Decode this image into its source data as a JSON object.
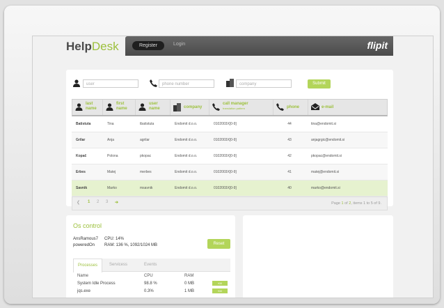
{
  "app": {
    "logo_bold": "Help",
    "logo_light": "Desk",
    "brand": "flipit"
  },
  "nav": {
    "register": "Register",
    "login": "Login"
  },
  "search": {
    "user_placeholder": "user",
    "phone_placeholder": "phone number",
    "company_placeholder": "company",
    "submit": "Submit"
  },
  "table": {
    "headers": [
      {
        "label": "last",
        "sub": "name",
        "icon": "user-icon"
      },
      {
        "label": "first",
        "sub": "name",
        "icon": "user-icon"
      },
      {
        "label": "user",
        "sub": "name",
        "icon": "user-icon"
      },
      {
        "label": "company",
        "sub": "",
        "icon": "building-icon"
      },
      {
        "label": "call manager",
        "sub": "translation pattern",
        "icon": "phone-icon"
      },
      {
        "label": "phone",
        "sub": "",
        "icon": "phone-icon"
      },
      {
        "label": "e-mail",
        "sub": "",
        "icon": "envelope-icon"
      }
    ],
    "rows": [
      [
        "Batistuta",
        "Tina",
        "tbatistuta",
        "Endomit d.o.o.",
        "0102003X[0-9]",
        "44",
        "tina@endomit.si"
      ],
      [
        "Grilar",
        "Anja",
        "agrilar",
        "Endomit d.o.o.",
        "0102003X[0-9]",
        "43",
        "anjagrgic@endomit.si"
      ],
      [
        "Kopač",
        "Polona",
        "pkopac",
        "Endomit d.o.o.",
        "0102003X[0-9]",
        "42",
        "pkopac@endomit.si"
      ],
      [
        "Erbes",
        "Matej",
        "merbes",
        "Endomit d.o.o.",
        "0102003X[0-9]",
        "41",
        "matej@endomit.si"
      ],
      [
        "Savnik",
        "Marko",
        "msavnik",
        "Endomit d.o.o.",
        "0102003X[0-9]",
        "40",
        "marko@endomit.si"
      ]
    ],
    "pager": {
      "pages": [
        "1",
        "2",
        "3"
      ],
      "info_prefix": "Page ",
      "info_page": "1",
      "info_mid": " of ",
      "info_total": "2",
      "info_suffix": ", items 1 to 5 of 9."
    }
  },
  "os": {
    "title": "Os control",
    "host": "AnsRamous7",
    "state": "poweredOn",
    "cpu": "CPU: 14%",
    "ram": "RAM: 136 %, 1092/1024 MB",
    "reset": "Reset",
    "tabs": [
      "Processes",
      "Servicess",
      "Events"
    ],
    "columns": [
      "Name",
      "CPU",
      "RAM"
    ],
    "processes": [
      {
        "name": "System Idle Process",
        "cpu": "98.8 %",
        "ram": "0 MB",
        "action": "Kill"
      },
      {
        "name": "jqs.exe",
        "cpu": "0.3%",
        "ram": "1 MB",
        "action": "Kill"
      }
    ]
  },
  "colors": {
    "accent": "#9cc03c",
    "button": "#b3d55a",
    "selected_row": "#e6f2cf"
  }
}
